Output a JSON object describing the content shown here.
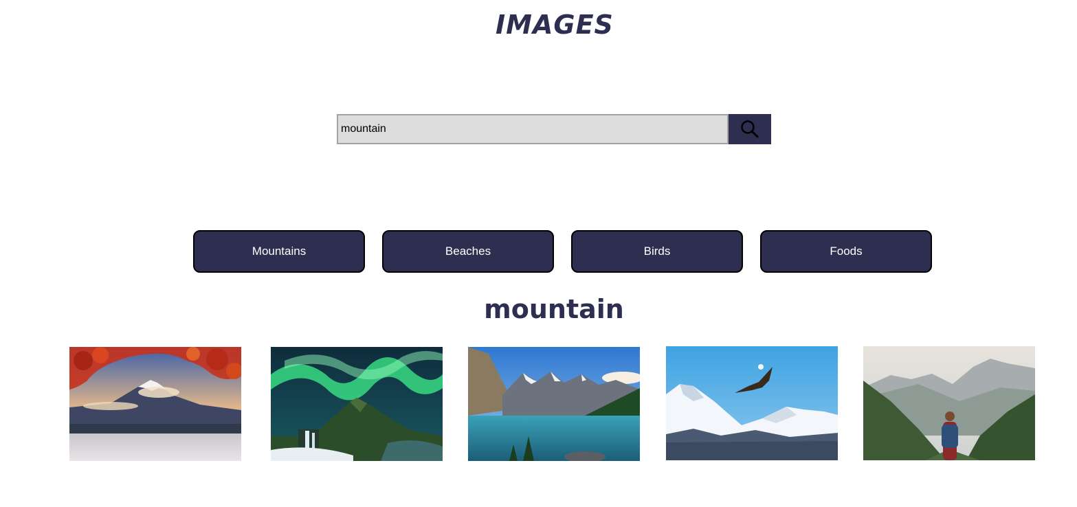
{
  "header": {
    "title": "IMAGES"
  },
  "search": {
    "value": "mountain",
    "button_icon": "search-icon"
  },
  "categories": [
    {
      "label": "Mountains"
    },
    {
      "label": "Beaches"
    },
    {
      "label": "Birds"
    },
    {
      "label": "Foods"
    }
  ],
  "results": {
    "heading": "mountain",
    "images": [
      {
        "subject": "snow-capped volcano with red autumn maple leaves over a lake"
      },
      {
        "subject": "green aurora borealis over a peaked mountain and waterfall"
      },
      {
        "subject": "turquoise alpine lake below rocky mountain range with pine forest"
      },
      {
        "subject": "eagle flying above snowy mountain ridges under blue sky"
      },
      {
        "subject": "hiker with backpack facing misty mountains and pine forest"
      }
    ]
  },
  "colors": {
    "primary": "#2e2e50",
    "input_background": "#dcdcdc",
    "input_border": "#a3a3a3",
    "button_text": "#ffffff"
  }
}
